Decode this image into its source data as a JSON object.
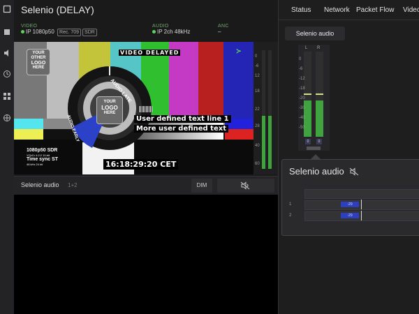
{
  "window": {
    "title": "Selenio (DELAY)"
  },
  "rail": {
    "icons": [
      "square-icon",
      "stack-icon",
      "audio-icon",
      "clock-icon",
      "grid-icon",
      "network-icon"
    ]
  },
  "signal": {
    "video": {
      "label": "VIDEO",
      "format": "IP 1080p50",
      "colorimetry": "Rec. 709",
      "range": "SDR"
    },
    "audio": {
      "label": "AUDIO",
      "format": "IP 2ch 48kHz"
    },
    "anc": {
      "label": "ANC",
      "value": "–"
    }
  },
  "testcard": {
    "video_delayed": "VIDEO DELAYED",
    "logo_top": [
      "YOUR",
      "OTHER",
      "LOGO",
      "HERE"
    ],
    "logo_center": [
      "YOUR",
      "LOGO",
      "HERE"
    ],
    "audio_late": "AUDIO LATE",
    "audio_early": "AUDIO EARLY",
    "user_line_1": "User defined text line 1",
    "user_line_2": "More user defined text",
    "info_1": "1080p50 SDR",
    "info_2": "YCbCr 4:2:2 10-bit",
    "info_3": "Time sync ST",
    "info_4": "48 kHz 24 bit",
    "timecode": "16:18:29:20 CET"
  },
  "meter_scale": [
    "4",
    "0",
    "-6",
    "12",
    "18",
    "22",
    "28",
    "40",
    "60"
  ],
  "audio_row": {
    "name": "Selenio audio",
    "channels": "1+2",
    "dim_label": "DIM"
  },
  "nav": {
    "items": [
      "Status",
      "Network",
      "Packet Flow",
      "Video"
    ]
  },
  "right": {
    "selected_button": "Selenio audio",
    "meter_labels": [
      "L",
      "R"
    ],
    "meter_scale": [
      "0",
      "-6",
      "-12",
      "-18",
      "-20",
      "-30",
      "-40",
      "-50",
      "-60"
    ],
    "meter_values": [
      "0",
      "0"
    ],
    "popup": {
      "title": "Selenio audio",
      "rows": [
        {
          "label": "1",
          "value": "-29"
        },
        {
          "label": "2",
          "value": "-29"
        }
      ]
    }
  },
  "colors": {
    "accent_green": "#5fd35f",
    "meter_green": "#3fa43f",
    "panel_bg": "#1a1a1a"
  }
}
